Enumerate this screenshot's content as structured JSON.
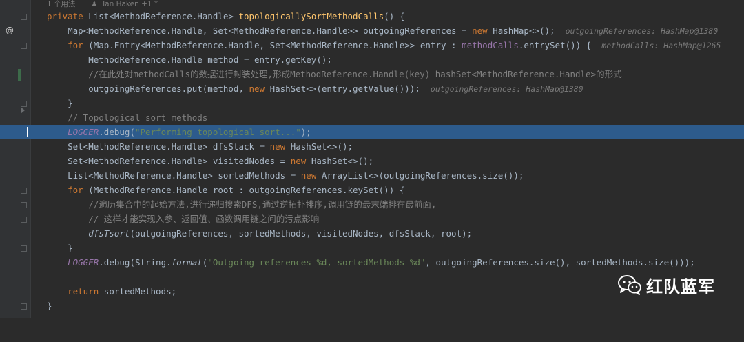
{
  "editor": {
    "meta": {
      "usages": "1 个用法",
      "author": "Ian Haken +1 *"
    },
    "gutter": {
      "at_marker": "@"
    },
    "lines": {
      "l1": {
        "k1": "private",
        "t1": " List<MethodReference.Handle> ",
        "fn": "topologicallySortMethodCalls",
        "t2": "() {"
      },
      "l2": {
        "t1": "    Map<MethodReference.Handle, Set<MethodReference.Handle>> outgoingReferences = ",
        "k1": "new",
        "t2": " HashMap<>();",
        "hint": "outgoingReferences: HashMap@1380"
      },
      "l3": {
        "k1": "    for",
        "t1": " (Map.Entry<MethodReference.Handle, Set<MethodReference.Handle>> entry : ",
        "f1": "methodCalls",
        "t2": ".entrySet()) {",
        "hint": "methodCalls: HashMap@1265"
      },
      "l4": {
        "t1": "        MethodReference.Handle method = entry.getKey();"
      },
      "l5": {
        "cm": "        //在此处对methodCalls的数据进行封装处理,形成MethodReference.Handle(key) hashSet<MethodReference.Handle>的形式"
      },
      "l6": {
        "t1": "        outgoingReferences.put(method, ",
        "k1": "new",
        "t2": " HashSet<>(entry.getValue()));",
        "hint": "outgoingReferences: HashMap@1380"
      },
      "l7": {
        "t1": "    }"
      },
      "l8": {
        "cm": "    // Topological sort methods"
      },
      "l9": {
        "st": "    LOGGER",
        "t1": ".debug(",
        "str": "\"Performing topological sort...\"",
        "t2": ");"
      },
      "l10": {
        "t1": "    Set<MethodReference.Handle> dfsStack = ",
        "k1": "new",
        "t2": " HashSet<>();"
      },
      "l11": {
        "t1": "    Set<MethodReference.Handle> visitedNodes = ",
        "k1": "new",
        "t2": " HashSet<>();"
      },
      "l12": {
        "t1": "    List<MethodReference.Handle> sortedMethods = ",
        "k1": "new",
        "t2": " ArrayList<>(outgoingReferences.size());"
      },
      "l13": {
        "k1": "    for",
        "t1": " (MethodReference.Handle root : outgoingReferences.keySet()) {"
      },
      "l14": {
        "cm": "        //遍历集合中的起始方法,进行递归搜索DFS,通过逆拓扑排序,调用链的最末端排在最前面,"
      },
      "l15": {
        "cm": "        // 这样才能实现入参、返回值、函数调用链之间的污点影响"
      },
      "l16": {
        "sti": "        dfsTsort",
        "t1": "(outgoingReferences, sortedMethods, visitedNodes, dfsStack, root);"
      },
      "l17": {
        "t1": "    }"
      },
      "l18": {
        "st": "    LOGGER",
        "t1": ".debug(String.",
        "sti": "format",
        "t2": "(",
        "str": "\"Outgoing references %d, sortedMethods %d\"",
        "t3": ", outgoingReferences.size(), sortedMethods.size()));"
      },
      "l20": {
        "k1": "    return",
        "t1": " sortedMethods;"
      },
      "l21": {
        "t1": "}"
      }
    }
  },
  "watermark": {
    "text": "红队蓝军",
    "icon": "wechat-icon",
    "color": "#ffffff"
  },
  "colors": {
    "background": "#2b2b2b",
    "highlight_line": "#2d5b8c",
    "keyword": "#cc7832",
    "method_decl": "#ffc66d",
    "field": "#9876aa",
    "string": "#6a8759",
    "comment": "#808080"
  }
}
